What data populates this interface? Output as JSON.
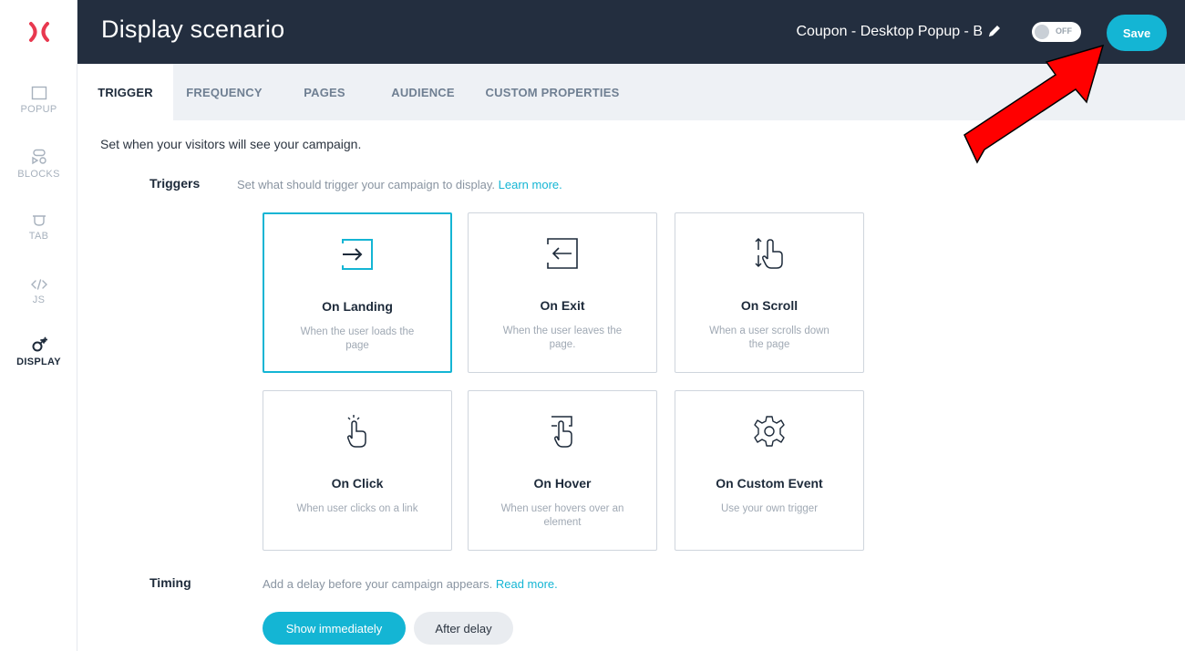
{
  "sidebar": {
    "items": [
      {
        "label": "POPUP",
        "icon": "popup-icon"
      },
      {
        "label": "BLOCKS",
        "icon": "blocks-icon"
      },
      {
        "label": "TAB",
        "icon": "tab-icon"
      },
      {
        "label": "JS",
        "icon": "code-icon"
      },
      {
        "label": "DISPLAY",
        "icon": "display-icon",
        "active": true
      }
    ]
  },
  "header": {
    "title": "Display scenario",
    "campaign_name": "Coupon - Desktop Popup - B",
    "toggle_label": "OFF",
    "save_label": "Save"
  },
  "tabs": [
    {
      "label": "TRIGGER",
      "active": true
    },
    {
      "label": "FREQUENCY"
    },
    {
      "label": "PAGES"
    },
    {
      "label": "AUDIENCE"
    },
    {
      "label": "CUSTOM PROPERTIES"
    }
  ],
  "intro": "Set when your visitors will see your campaign.",
  "triggers": {
    "label": "Triggers",
    "desc": "Set what should trigger your campaign to display.",
    "link": "Learn more.",
    "cards": [
      {
        "title": "On Landing",
        "desc": "When the user loads the page",
        "icon": "landing-icon",
        "selected": true
      },
      {
        "title": "On Exit",
        "desc": "When the user leaves the page.",
        "icon": "exit-icon"
      },
      {
        "title": "On Scroll",
        "desc": "When a user scrolls down the page",
        "icon": "scroll-icon"
      },
      {
        "title": "On Click",
        "desc": "When user clicks on a link",
        "icon": "click-icon"
      },
      {
        "title": "On Hover",
        "desc": "When user hovers over an element",
        "icon": "hover-icon"
      },
      {
        "title": "On Custom Event",
        "desc": "Use your own trigger",
        "icon": "gear-icon"
      }
    ]
  },
  "timing": {
    "label": "Timing",
    "desc": "Add a delay before your campaign appears.",
    "link": "Read more.",
    "options": [
      {
        "label": "Show immediately",
        "selected": true
      },
      {
        "label": "After delay"
      }
    ]
  },
  "colors": {
    "accent": "#14b5d4",
    "header_bg": "#232e3f",
    "logo": "#e8384f",
    "annotation_arrow": "#ff0000"
  }
}
